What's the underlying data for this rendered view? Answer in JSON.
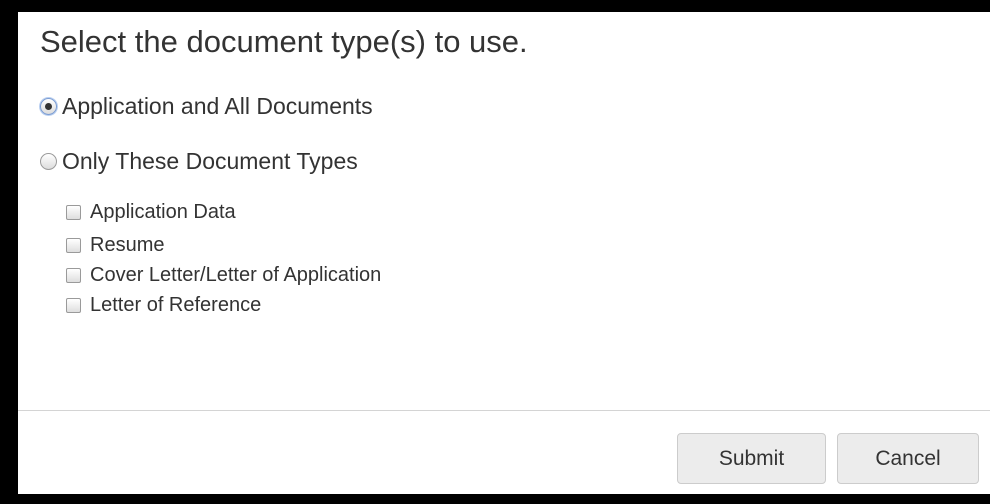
{
  "dialog": {
    "title": "Select the document type(s) to use.",
    "options": [
      {
        "label": "Application and All Documents",
        "selected": true
      },
      {
        "label": "Only These Document Types",
        "selected": false
      }
    ],
    "document_types": [
      {
        "label": "Application Data",
        "checked": false
      },
      {
        "label": "Resume",
        "checked": false
      },
      {
        "label": "Cover Letter/Letter of Application",
        "checked": false
      },
      {
        "label": "Letter of Reference",
        "checked": false
      }
    ],
    "buttons": {
      "submit_label": "Submit",
      "cancel_label": "Cancel"
    }
  },
  "colors": {
    "background": "#000000",
    "dialog": "#ffffff",
    "text": "#333333",
    "button_bg": "#ececec",
    "divider": "#d4d4d4"
  }
}
